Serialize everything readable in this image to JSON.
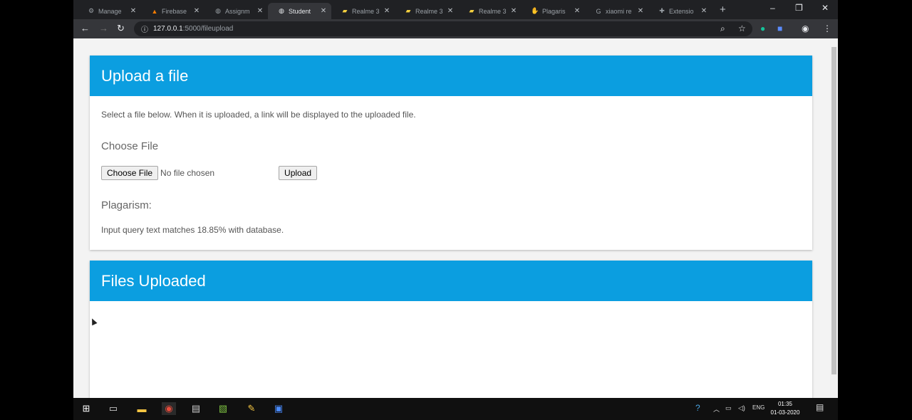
{
  "browser": {
    "tabs": [
      {
        "title": "Manage",
        "icon": "gear-icon"
      },
      {
        "title": "Firebase",
        "icon": "firebase-icon"
      },
      {
        "title": "Assignm",
        "icon": "globe-icon"
      },
      {
        "title": "Student",
        "icon": "globe-icon",
        "active": true
      },
      {
        "title": "Realme 3",
        "icon": "sheet-icon"
      },
      {
        "title": "Realme 3",
        "icon": "sheet-icon"
      },
      {
        "title": "Realme 3",
        "icon": "sheet-icon"
      },
      {
        "title": "Plagaris",
        "icon": "hand-icon"
      },
      {
        "title": "xiaomi re",
        "icon": "google-icon"
      },
      {
        "title": "Extensio",
        "icon": "puzzle-icon"
      }
    ],
    "url_host": "127.0.0.1",
    "url_path": ":5000/fileupload"
  },
  "upload": {
    "title": "Upload a file",
    "description": "Select a file below. When it is uploaded, a link will be displayed to the uploaded file.",
    "choose_label": "Choose File",
    "choose_button": "Choose File",
    "no_file": "No file chosen",
    "upload_button": "Upload",
    "plagiarism_label": "Plagarism:",
    "result": "Input query text matches 18.85% with database."
  },
  "files": {
    "title": "Files Uploaded"
  },
  "taskbar": {
    "language": "ENG",
    "time": "01:35",
    "date": "01-03-2020"
  },
  "colors": {
    "accent": "#0b9ee0"
  }
}
